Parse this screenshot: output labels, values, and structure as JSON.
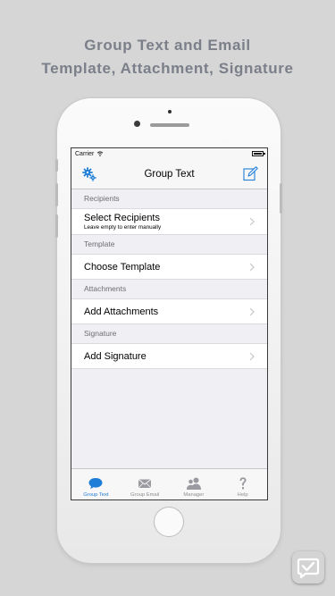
{
  "headline": {
    "line1": "Group Text and Email",
    "line2": "Template, Attachment, Signature"
  },
  "status_bar": {
    "carrier": "Carrier",
    "wifi_icon": "wifi-icon",
    "battery_icon": "battery-icon"
  },
  "nav_bar": {
    "title": "Group Text",
    "left_icon": "gear-icon",
    "right_icon": "compose-icon"
  },
  "sections": [
    {
      "header": "Recipients",
      "row_label": "Select Recipients",
      "row_sublabel": "Leave empty to enter manually"
    },
    {
      "header": "Template",
      "row_label": "Choose Template"
    },
    {
      "header": "Attachments",
      "row_label": "Add Attachments"
    },
    {
      "header": "Signature",
      "row_label": "Add Signature"
    }
  ],
  "tab_bar": {
    "items": [
      {
        "label": "Group Text",
        "icon": "chat-bubble-icon",
        "active": true
      },
      {
        "label": "Group Email",
        "icon": "envelope-icon",
        "active": false
      },
      {
        "label": "Manager",
        "icon": "people-icon",
        "active": false
      },
      {
        "label": "Help",
        "icon": "question-icon",
        "active": false
      }
    ]
  },
  "colors": {
    "accent": "#1e7dd6",
    "background": "#d6d6d6",
    "headline": "#7b7f8a",
    "table_background": "#efeff4",
    "inactive_tab": "#8e8e93"
  }
}
